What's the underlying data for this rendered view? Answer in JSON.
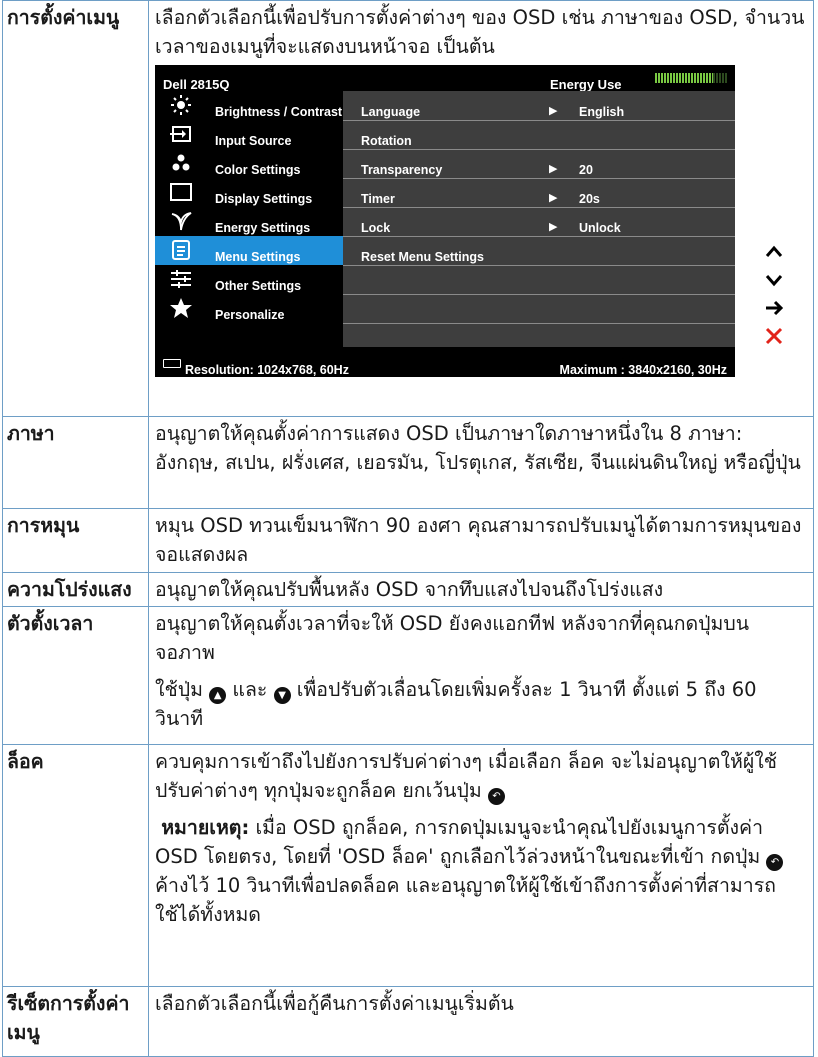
{
  "rows": [
    {
      "term": "การตั้งค่าเมนู",
      "desc": "เลือกตัวเลือกนี้เพื่อปรับการตั้งค่าต่างๆ ของ OSD เช่น ภาษาของ OSD, จำนวนเวลาของเมนูที่จะแสดงบนหน้าจอ เป็นต้น"
    },
    {
      "term": "ภาษา",
      "desc": "อนุญาตให้คุณตั้งค่าการแสดง OSD เป็นภาษาใดภาษาหนึ่งใน 8 ภาษา: อังกฤษ, สเปน, ฝรั่งเศส, เยอรมัน, โปรตุเกส, รัสเซีย, จีนแผ่นดินใหญ่ หรือญี่ปุ่น"
    },
    {
      "term": "การหมุน",
      "desc": "หมุน OSD ทวนเข็มนาฬิกา 90 องศา คุณสามารถปรับเมนูได้ตามการหมุนของจอแสดงผล"
    },
    {
      "term": "ความโปร่งแสง",
      "desc": "อนุญาตให้คุณปรับพื้นหลัง OSD จากทึบแสงไปจนถึงโปร่งแสง"
    },
    {
      "term": "ตัวตั้งเวลา",
      "desc": "อนุญาตให้คุณตั้งเวลาที่จะให้ OSD ยังคงแอกทีฟ หลังจากที่คุณกดปุ่มบนจอภาพ",
      "desc2_pre": "ใช้ปุ่ม ",
      "desc2_mid": " และ ",
      "desc2_post": " เพื่อปรับตัวเลื่อนโดยเพิ่มครั้งละ 1 วินาที ตั้งแต่ 5 ถึง 60 วินาที"
    },
    {
      "term": "ล็อค",
      "desc_pre": "ควบคุมการเข้าถึงไปยังการปรับค่าต่างๆ เมื่อเลือก ล็อค จะไม่อนุญาตให้ผู้ใช้ปรับค่าต่างๆ ทุกปุ่มจะถูกล็อค ยกเว้นปุ่ม ",
      "note_label": "หมายเหตุ:",
      "note_pre": " เมื่อ OSD ถูกล็อค, การกดปุ่มเมนูจะนำคุณไปยังเมนูการตั้งค่า OSD โดยตรง, โดยที่ 'OSD ล็อค' ถูกเลือกไว้ล่วงหน้าในขณะที่เข้า กดปุ่ม ",
      "note_post": " ค้างไว้ 10 วินาทีเพื่อปลดล็อค และอนุญาตให้ผู้ใช้เข้าถึงการตั้งค่าที่สามารถใช้ได้ทั้งหมด"
    },
    {
      "term": "รีเซ็ตการตั้งค่าเมนู",
      "desc": "เลือกตัวเลือกนี้เพื่อกู้คืนการตั้งค่าเมนูเริ่มต้น"
    }
  ],
  "osd": {
    "model": "Dell 2815Q",
    "energy_label": "Energy Use",
    "menu": [
      {
        "label": "Brightness / Contrast",
        "icon": "sun-icon"
      },
      {
        "label": "Input Source",
        "icon": "input-source-icon"
      },
      {
        "label": "Color Settings",
        "icon": "color-dots-icon"
      },
      {
        "label": "Display Settings",
        "icon": "display-rect-icon"
      },
      {
        "label": "Energy Settings",
        "icon": "leaf-icon"
      },
      {
        "label": "Menu Settings",
        "icon": "menu-doc-icon",
        "selected": true
      },
      {
        "label": "Other Settings",
        "icon": "sliders-icon"
      },
      {
        "label": "Personalize",
        "icon": "star-icon"
      }
    ],
    "options": [
      {
        "label": "Language",
        "arrow": "▶",
        "value": "English"
      },
      {
        "label": "Rotation",
        "arrow": "",
        "value": ""
      },
      {
        "label": "Transparency",
        "arrow": "▶",
        "value": "20"
      },
      {
        "label": "Timer",
        "arrow": "▶",
        "value": "20s"
      },
      {
        "label": "Lock",
        "arrow": "▶",
        "value": "Unlock"
      },
      {
        "label": "Reset Menu Settings",
        "arrow": "",
        "value": ""
      },
      {
        "label": "",
        "arrow": "",
        "value": ""
      },
      {
        "label": "",
        "arrow": "",
        "value": ""
      }
    ],
    "resolution": "Resolution: 1024x768,  60Hz",
    "maximum": "Maximum : 3840x2160,  30Hz",
    "side_buttons": [
      "up-icon",
      "down-icon",
      "enter-icon",
      "exit-icon"
    ],
    "colors": {
      "selected": "#1f8fd8",
      "panel": "#3e3e3e",
      "energy": "#7ac943",
      "exit": "#e2231a"
    }
  }
}
